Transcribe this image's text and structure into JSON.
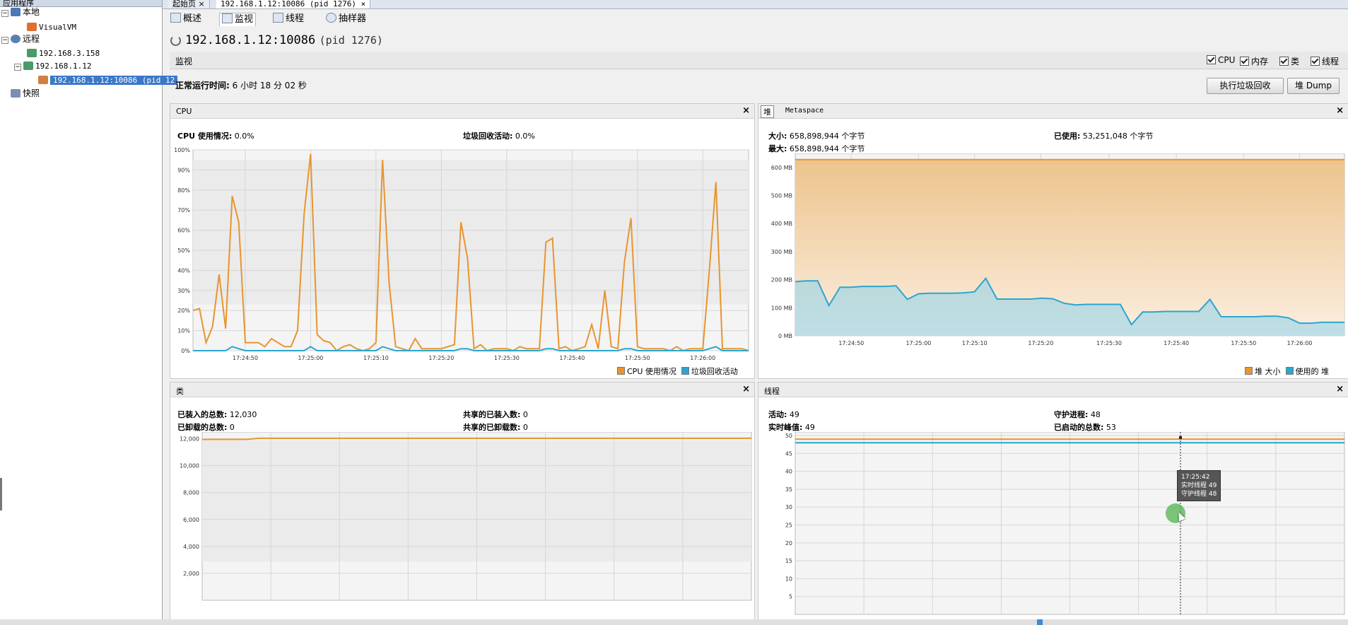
{
  "left": {
    "title": "应用程序",
    "items": [
      {
        "label": "本地"
      },
      {
        "label": "VisualVM"
      },
      {
        "label": "远程"
      },
      {
        "label": "192.168.3.158"
      },
      {
        "label": "192.168.1.12"
      },
      {
        "label": "192.168.1.12:10086 (pid 12"
      },
      {
        "label": "快照"
      }
    ]
  },
  "tabs": [
    {
      "label": "起始页"
    },
    {
      "label": "192.168.1.12:10086 (pid 1276)"
    }
  ],
  "subtabs": [
    {
      "label": "概述"
    },
    {
      "label": "监视"
    },
    {
      "label": "线程"
    },
    {
      "label": "抽样器"
    }
  ],
  "header": {
    "title": "192.168.1.12:10086",
    "pid": "(pid 1276)"
  },
  "monitor": {
    "label": "监视",
    "checks": [
      {
        "label": "CPU"
      },
      {
        "label": "内存"
      },
      {
        "label": "类"
      },
      {
        "label": "线程"
      }
    ],
    "uptime_label": "正常运行时间:",
    "uptime_value": "6 小时 18 分 02 秒",
    "gc_button": "执行垃圾回收",
    "dump_button": "堆 Dump"
  },
  "cpu_panel": {
    "title": "CPU",
    "usage_label": "CPU 使用情况:",
    "usage_value": "0.0%",
    "gc_label": "垃圾回收活动:",
    "gc_value": "0.0%",
    "legend": [
      "CPU 使用情况",
      "垃圾回收活动"
    ]
  },
  "heap_panel": {
    "tab_heap": "堆",
    "tab_meta": "Metaspace",
    "size_label": "大小:",
    "size_value": "658,898,944 个字节",
    "max_label": "最大:",
    "max_value": "658,898,944 个字节",
    "used_label": "已使用:",
    "used_value": "53,251,048 个字节",
    "legend": [
      "堆 大小",
      "使用的 堆"
    ]
  },
  "class_panel": {
    "title": "类",
    "loaded_label": "已装入的总数:",
    "loaded_value": "12,030",
    "unloaded_label": "已卸载的总数:",
    "unloaded_value": "0",
    "shared_loaded_label": "共享的已装入数:",
    "shared_loaded_value": "0",
    "shared_unloaded_label": "共享的已卸载数:",
    "shared_unloaded_value": "0"
  },
  "thread_panel": {
    "title": "线程",
    "live_label": "活动:",
    "live_value": "49",
    "peak_label": "实时峰值:",
    "peak_value": "49",
    "daemon_label": "守护进程:",
    "daemon_value": "48",
    "started_label": "已启动的总数:",
    "started_value": "53",
    "tooltip": {
      "time": "17:25:42",
      "live": "实时线程  49",
      "daemon": "守护线程  48"
    }
  },
  "colors": {
    "orange": "#e8952e",
    "blue": "#2aa6cf",
    "selection": "#3a78c8"
  },
  "chart_data": [
    {
      "type": "line",
      "name": "CPU",
      "x": [
        "17:24:42",
        "17:24:43",
        "17:24:44",
        "17:24:45",
        "17:24:46",
        "17:24:47",
        "17:24:48",
        "17:24:49",
        "17:24:50",
        "17:24:51",
        "17:24:52",
        "17:24:53",
        "17:24:54",
        "17:24:55",
        "17:24:56",
        "17:24:57",
        "17:24:58",
        "17:24:59",
        "17:25:00",
        "17:25:01",
        "17:25:02",
        "17:25:03",
        "17:25:04",
        "17:25:05",
        "17:25:06",
        "17:25:07",
        "17:25:08",
        "17:25:09",
        "17:25:10",
        "17:25:11",
        "17:25:12",
        "17:25:13",
        "17:25:14",
        "17:25:15",
        "17:25:16",
        "17:25:17",
        "17:25:18",
        "17:25:19",
        "17:25:20",
        "17:25:21",
        "17:25:22",
        "17:25:23",
        "17:25:24",
        "17:25:25",
        "17:25:26",
        "17:25:27",
        "17:25:28",
        "17:25:29",
        "17:25:30",
        "17:25:31",
        "17:25:32",
        "17:25:33",
        "17:25:34",
        "17:25:35",
        "17:25:36",
        "17:25:37",
        "17:25:38",
        "17:25:39",
        "17:25:40",
        "17:25:41",
        "17:25:42",
        "17:25:43",
        "17:25:44",
        "17:25:45",
        "17:25:46",
        "17:25:47",
        "17:25:48",
        "17:25:49",
        "17:25:50",
        "17:25:51",
        "17:25:52",
        "17:25:53",
        "17:25:54",
        "17:25:55",
        "17:25:56",
        "17:25:57",
        "17:25:58",
        "17:25:59",
        "17:26:00",
        "17:26:01",
        "17:26:02",
        "17:26:03",
        "17:26:04",
        "17:26:05",
        "17:26:06",
        "17:26:07"
      ],
      "series": [
        {
          "name": "CPU 使用情况",
          "values": [
            20,
            21,
            4,
            12,
            38,
            11,
            77,
            64,
            4,
            4,
            4,
            2,
            6,
            4,
            2,
            2,
            10,
            68,
            98,
            8,
            5,
            4,
            0,
            2,
            3,
            1,
            0,
            1,
            4,
            95,
            34,
            2,
            1,
            0,
            6,
            1,
            1,
            1,
            1,
            2,
            3,
            64,
            46,
            1,
            3,
            0,
            1,
            1,
            1,
            0,
            2,
            1,
            1,
            1,
            54,
            56,
            1,
            2,
            0,
            1,
            2,
            13,
            1,
            30,
            2,
            1,
            44,
            66,
            2,
            1,
            1,
            1,
            1,
            0,
            2,
            0,
            1,
            1,
            1,
            40,
            84,
            1,
            1,
            1,
            1,
            0
          ]
        },
        {
          "name": "垃圾回收活动",
          "values": [
            0,
            0,
            0,
            0,
            0,
            0,
            2,
            1,
            0,
            0,
            0,
            0,
            0,
            0,
            0,
            0,
            0,
            0,
            2,
            0,
            0,
            0,
            0,
            0,
            0,
            0,
            0,
            0,
            0,
            2,
            1,
            0,
            0,
            0,
            0,
            0,
            0,
            0,
            0,
            0,
            0,
            1,
            1,
            0,
            0,
            0,
            0,
            0,
            0,
            0,
            0,
            0,
            0,
            0,
            1,
            1,
            0,
            0,
            0,
            0,
            0,
            0,
            0,
            0,
            0,
            0,
            1,
            1,
            0,
            0,
            0,
            0,
            0,
            0,
            0,
            0,
            0,
            0,
            0,
            1,
            2,
            0,
            0,
            0,
            0,
            0
          ]
        }
      ],
      "ylim": [
        0,
        100
      ],
      "y_ticks": [
        "0%",
        "10%",
        "20%",
        "30%",
        "40%",
        "50%",
        "60%",
        "70%",
        "80%",
        "90%",
        "100%"
      ],
      "x_ticks": [
        "17:24:50",
        "17:25:00",
        "17:25:10",
        "17:25:20",
        "17:25:30",
        "17:25:40",
        "17:25:50",
        "17:26:00"
      ]
    },
    {
      "type": "area",
      "name": "堆",
      "x": [
        "17:24:42",
        "17:24:44",
        "17:24:46",
        "17:24:47",
        "17:24:48",
        "17:24:50",
        "17:24:52",
        "17:24:54",
        "17:24:56",
        "17:24:58",
        "17:24:59",
        "17:25:00",
        "17:25:02",
        "17:25:04",
        "17:25:06",
        "17:25:08",
        "17:25:10",
        "17:25:12",
        "17:25:13",
        "17:25:14",
        "17:25:16",
        "17:25:18",
        "17:25:19",
        "17:25:21",
        "17:25:22",
        "17:25:24",
        "17:25:26",
        "17:25:28",
        "17:25:30",
        "17:25:32",
        "17:25:33",
        "17:25:34",
        "17:25:36",
        "17:25:38",
        "17:25:40",
        "17:25:42",
        "17:25:44",
        "17:25:46",
        "17:25:47",
        "17:25:48",
        "17:25:50",
        "17:25:52",
        "17:25:54",
        "17:25:56",
        "17:25:58",
        "17:26:00",
        "17:26:02",
        "17:26:04",
        "17:26:06",
        "17:26:07"
      ],
      "series": [
        {
          "name": "堆 大小",
          "values": [
            628,
            628,
            628,
            628,
            628,
            628,
            628,
            628,
            628,
            628,
            628,
            628,
            628,
            628,
            628,
            628,
            628,
            628,
            628,
            628,
            628,
            628,
            628,
            628,
            628,
            628,
            628,
            628,
            628,
            628,
            628,
            628,
            628,
            628,
            628,
            628,
            628,
            628,
            628,
            628,
            628,
            628,
            628,
            628,
            628,
            628,
            628,
            628,
            628,
            628
          ]
        },
        {
          "name": "使用的 堆",
          "values": [
            193,
            196,
            196,
            108,
            173,
            173,
            176,
            176,
            176,
            178,
            130,
            150,
            152,
            152,
            152,
            153,
            157,
            205,
            131,
            131,
            131,
            131,
            134,
            132,
            116,
            110,
            112,
            112,
            112,
            112,
            40,
            85,
            85,
            87,
            87,
            87,
            87,
            130,
            68,
            68,
            68,
            68,
            70,
            70,
            64,
            45,
            45,
            48,
            48,
            48
          ]
        }
      ],
      "y_ticks": [
        "0 MB",
        "100 MB",
        "200 MB",
        "300 MB",
        "400 MB",
        "500 MB",
        "600 MB"
      ],
      "ylim": [
        0,
        650
      ],
      "x_ticks": [
        "17:24:50",
        "17:25:00",
        "17:25:10",
        "17:25:20",
        "17:25:30",
        "17:25:40",
        "17:25:50",
        "17:26:00"
      ]
    },
    {
      "type": "line",
      "name": "类",
      "series": [
        {
          "name": "已装入的总数",
          "values": [
            11950,
            11950,
            11950,
            11950,
            11950,
            12030,
            12030,
            12030,
            12030,
            12030,
            12030,
            12030,
            12030,
            12030,
            12030,
            12030,
            12030,
            12030,
            12030,
            12030,
            12030,
            12030,
            12030,
            12030,
            12030,
            12030,
            12030,
            12030,
            12030,
            12030,
            12030,
            12030,
            12030,
            12030,
            12030,
            12030,
            12030,
            12030,
            12030,
            12030,
            12030,
            12030,
            12030,
            12030,
            12030,
            12030,
            12030,
            12030,
            12030,
            12030
          ]
        }
      ],
      "y_ticks": [
        "2,000",
        "4,000",
        "6,000",
        "8,000",
        "10,000",
        "12,000"
      ],
      "ylim": [
        0,
        12500
      ]
    },
    {
      "type": "line",
      "name": "线程",
      "series": [
        {
          "name": "实时线程",
          "values": [
            49,
            49
          ]
        },
        {
          "name": "守护线程",
          "values": [
            48,
            48
          ]
        }
      ],
      "y_ticks": [
        "5",
        "10",
        "15",
        "20",
        "25",
        "30",
        "35",
        "40",
        "45",
        "50"
      ],
      "ylim": [
        0,
        51
      ]
    }
  ]
}
